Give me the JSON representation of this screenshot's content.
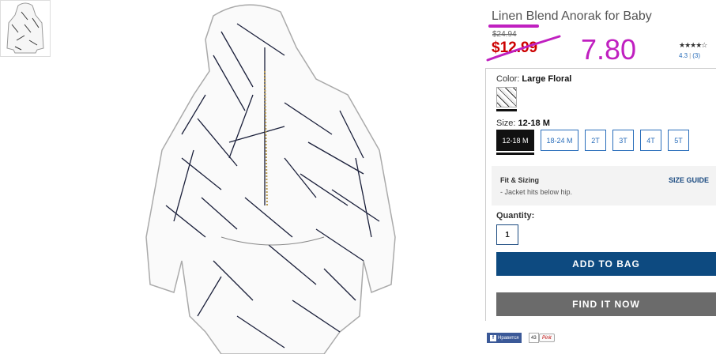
{
  "product": {
    "title": "Linen Blend Anorak for Baby",
    "original_price": "$24.94",
    "sale_price": "$12.99",
    "annotation_price": "7.80",
    "rating_stars": "★★★★☆",
    "rating_value": "4.3",
    "rating_sep": "|",
    "review_count": "(3)"
  },
  "color": {
    "label": "Color:",
    "value": "Large Floral"
  },
  "size": {
    "label": "Size:",
    "value": "12-18 M",
    "options": [
      "12-18 M",
      "18-24 M",
      "2T",
      "3T",
      "4T",
      "5T"
    ],
    "selected": "12-18 M"
  },
  "fit": {
    "title": "Fit & Sizing",
    "size_guide": "SIZE GUIDE",
    "note": "- Jacket hits below hip."
  },
  "quantity": {
    "label": "Quantity:",
    "value": "1"
  },
  "actions": {
    "add_to_bag": "ADD TO BAG",
    "find_it_now": "FIND IT NOW"
  },
  "social": {
    "fb_label": "Нравится",
    "fb_count": "43",
    "pin_label": "Pinit"
  },
  "colors": {
    "annotation": "#c020c0",
    "sale": "#cc0000",
    "primary_button": "#0d4a80",
    "secondary_button": "#6b6b6b",
    "link": "#2a6ebb"
  }
}
